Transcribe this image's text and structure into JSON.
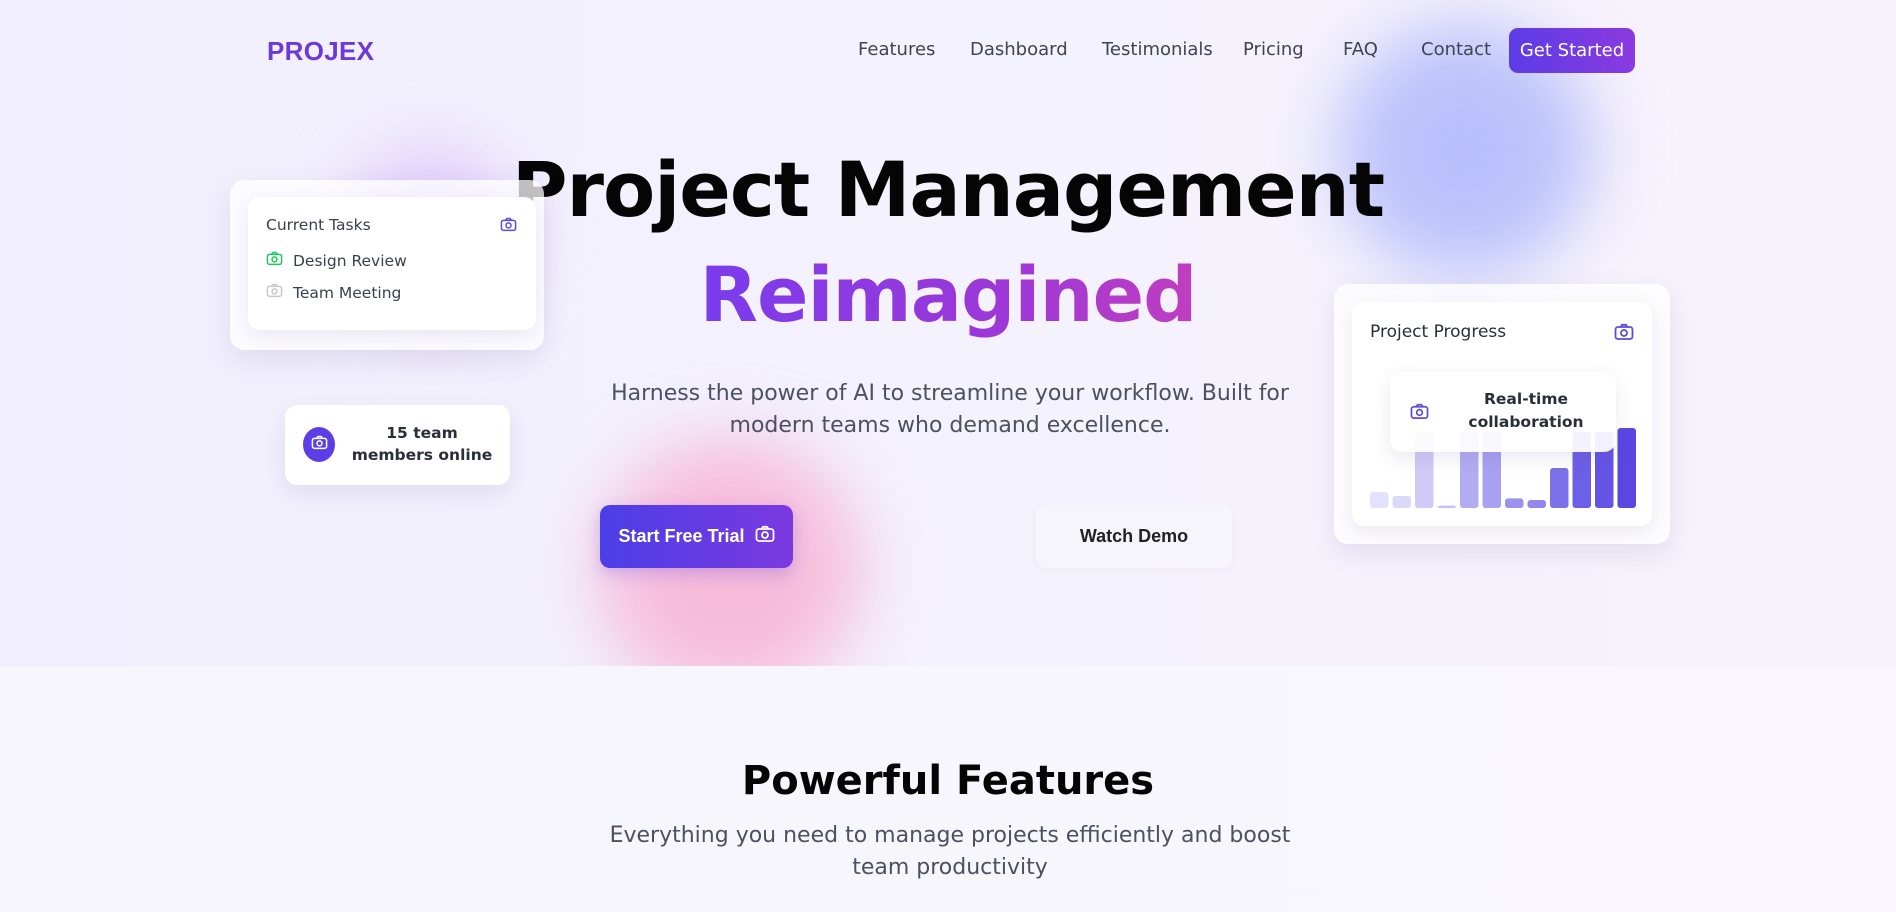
{
  "brand": {
    "logo": "PROJEX"
  },
  "nav": {
    "links": [
      "Features",
      "Dashboard",
      "Testimonials",
      "Pricing",
      "FAQ",
      "Contact"
    ],
    "cta": "Get Started"
  },
  "hero": {
    "title_line1": "Project Management",
    "title_line2": "Reimagined",
    "subtitle": "Harness the power of AI to streamline your workflow. Built for modern teams who demand excellence.",
    "primary_button": "Start Free Trial",
    "secondary_button": "Watch Demo"
  },
  "tasks_card": {
    "title": "Current Tasks",
    "icon": "camera-icon",
    "items": [
      {
        "label": "Design Review",
        "status_color": "#22c55e"
      },
      {
        "label": "Team Meeting",
        "status_color": "#c7c9d1"
      }
    ]
  },
  "members_card": {
    "text": "15 team members online",
    "icon": "camera-icon"
  },
  "progress_card": {
    "title": "Project Progress",
    "icon": "camera-icon",
    "bars": [
      0.2,
      0.15,
      0.95,
      0.03,
      0.95,
      0.95,
      0.12,
      0.1,
      0.5,
      0.95,
      0.95,
      1.0
    ],
    "bar_colors": [
      "#e4e1fb",
      "#dcd8fa",
      "#cfcaf6",
      "#c5bff5",
      "#b3acf2",
      "#a8a0f0",
      "#9c92ee",
      "#9188ed",
      "#7d71ea",
      "#6d5fe6",
      "#6554e5",
      "#5a47e2"
    ]
  },
  "collab_card": {
    "text": "Real-time collaboration",
    "icon": "camera-icon"
  },
  "features": {
    "title": "Powerful Features",
    "subtitle": "Everything you need to manage projects efficiently and boost team productivity"
  },
  "colors": {
    "accent": "#5b3ce6",
    "accent_end": "#8b3ae0",
    "logo": "#6d3ad9"
  }
}
